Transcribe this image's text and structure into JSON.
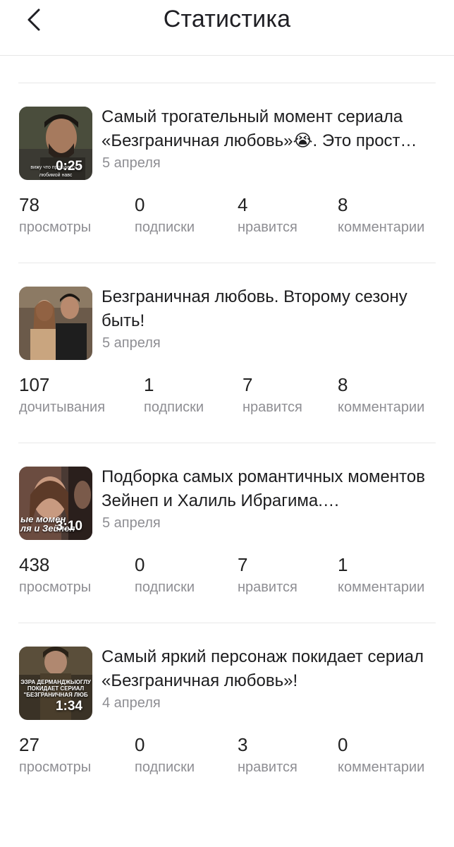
{
  "header": {
    "title": "Статистика"
  },
  "posts": [
    {
      "title": "Самый трогательный момент сериала «Безграничная любовь»😭. Это прост…",
      "date": "5 апреля",
      "duration": "0:25",
      "thumb_caption": "вижу что прощается с любимой навс",
      "stats": [
        {
          "value": "78",
          "label": "просмотры"
        },
        {
          "value": "0",
          "label": "подписки"
        },
        {
          "value": "4",
          "label": "нравится"
        },
        {
          "value": "8",
          "label": "комментарии"
        }
      ]
    },
    {
      "title": "Безграничная любовь. Второму сезону быть!",
      "date": "5 апреля",
      "stats": [
        {
          "value": "107",
          "label": "дочитывания"
        },
        {
          "value": "1",
          "label": "подписки"
        },
        {
          "value": "7",
          "label": "нравится"
        },
        {
          "value": "8",
          "label": "комментарии"
        }
      ]
    },
    {
      "title": "Подборка самых романтичных моментов Зейнеп и Халиль Ибрагима.…",
      "date": "5 апреля",
      "duration": "3:10",
      "thumb_caption": "ые момен\nля и Зейнеп",
      "stats": [
        {
          "value": "438",
          "label": "просмотры"
        },
        {
          "value": "0",
          "label": "подписки"
        },
        {
          "value": "7",
          "label": "нравится"
        },
        {
          "value": "1",
          "label": "комментарии"
        }
      ]
    },
    {
      "title": "Самый яркий персонаж покидает сериал «Безграничная любовь»!",
      "date": "4 апреля",
      "duration": "1:34",
      "thumb_caption": "ЭЗРА ДЕРМАНДЖЫОГЛУ\nПОКИДАЕТ СЕРИАЛ\n\"БЕЗГРАНИЧНАЯ ЛЮБ",
      "stats": [
        {
          "value": "27",
          "label": "просмотры"
        },
        {
          "value": "0",
          "label": "подписки"
        },
        {
          "value": "3",
          "label": "нравится"
        },
        {
          "value": "0",
          "label": "комментарии"
        }
      ]
    }
  ],
  "colors": {
    "text": "#1c1c1e",
    "secondary": "#8e8e93",
    "divider": "#e8e8e8"
  }
}
